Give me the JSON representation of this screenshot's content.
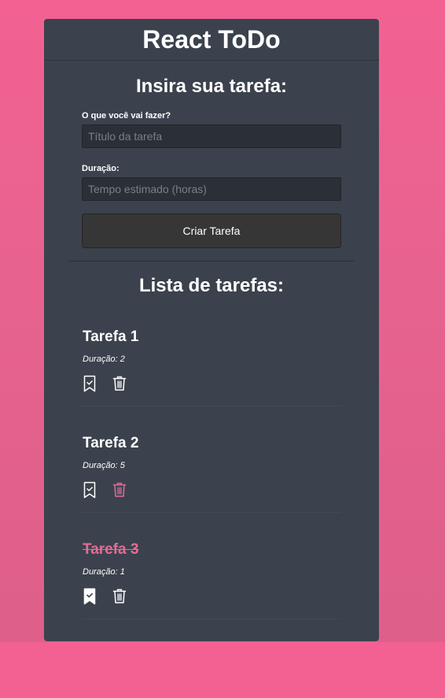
{
  "app": {
    "title": "React ToDo"
  },
  "form": {
    "heading": "Insira sua tarefa:",
    "title_label": "O que você vai fazer?",
    "title_placeholder": "Título da tarefa",
    "title_value": "",
    "duration_label": "Duração:",
    "duration_placeholder": "Tempo estimado (horas)",
    "duration_value": "",
    "submit_label": "Criar Tarefa"
  },
  "list": {
    "heading": "Lista de tarefas:",
    "tasks": [
      {
        "title": "Tarefa 1",
        "duration": "Duração: 2",
        "done": false,
        "bookmark_icon": "bookmark-check-icon",
        "delete_icon": "trash-icon",
        "delete_color": "#ffffff"
      },
      {
        "title": "Tarefa 2",
        "duration": "Duração: 5",
        "done": false,
        "bookmark_icon": "bookmark-check-icon",
        "delete_icon": "trash-icon",
        "delete_color": "#e46b95"
      },
      {
        "title": "Tarefa 3",
        "duration": "Duração: 1",
        "done": true,
        "bookmark_icon": "bookmark-check-fill-icon",
        "delete_icon": "trash-icon",
        "delete_color": "#ffffff"
      }
    ]
  },
  "colors": {
    "background": "#f26192",
    "panel": "#3b424d",
    "accent": "#e46b95",
    "input": "#2b2f36",
    "button": "#363636"
  }
}
